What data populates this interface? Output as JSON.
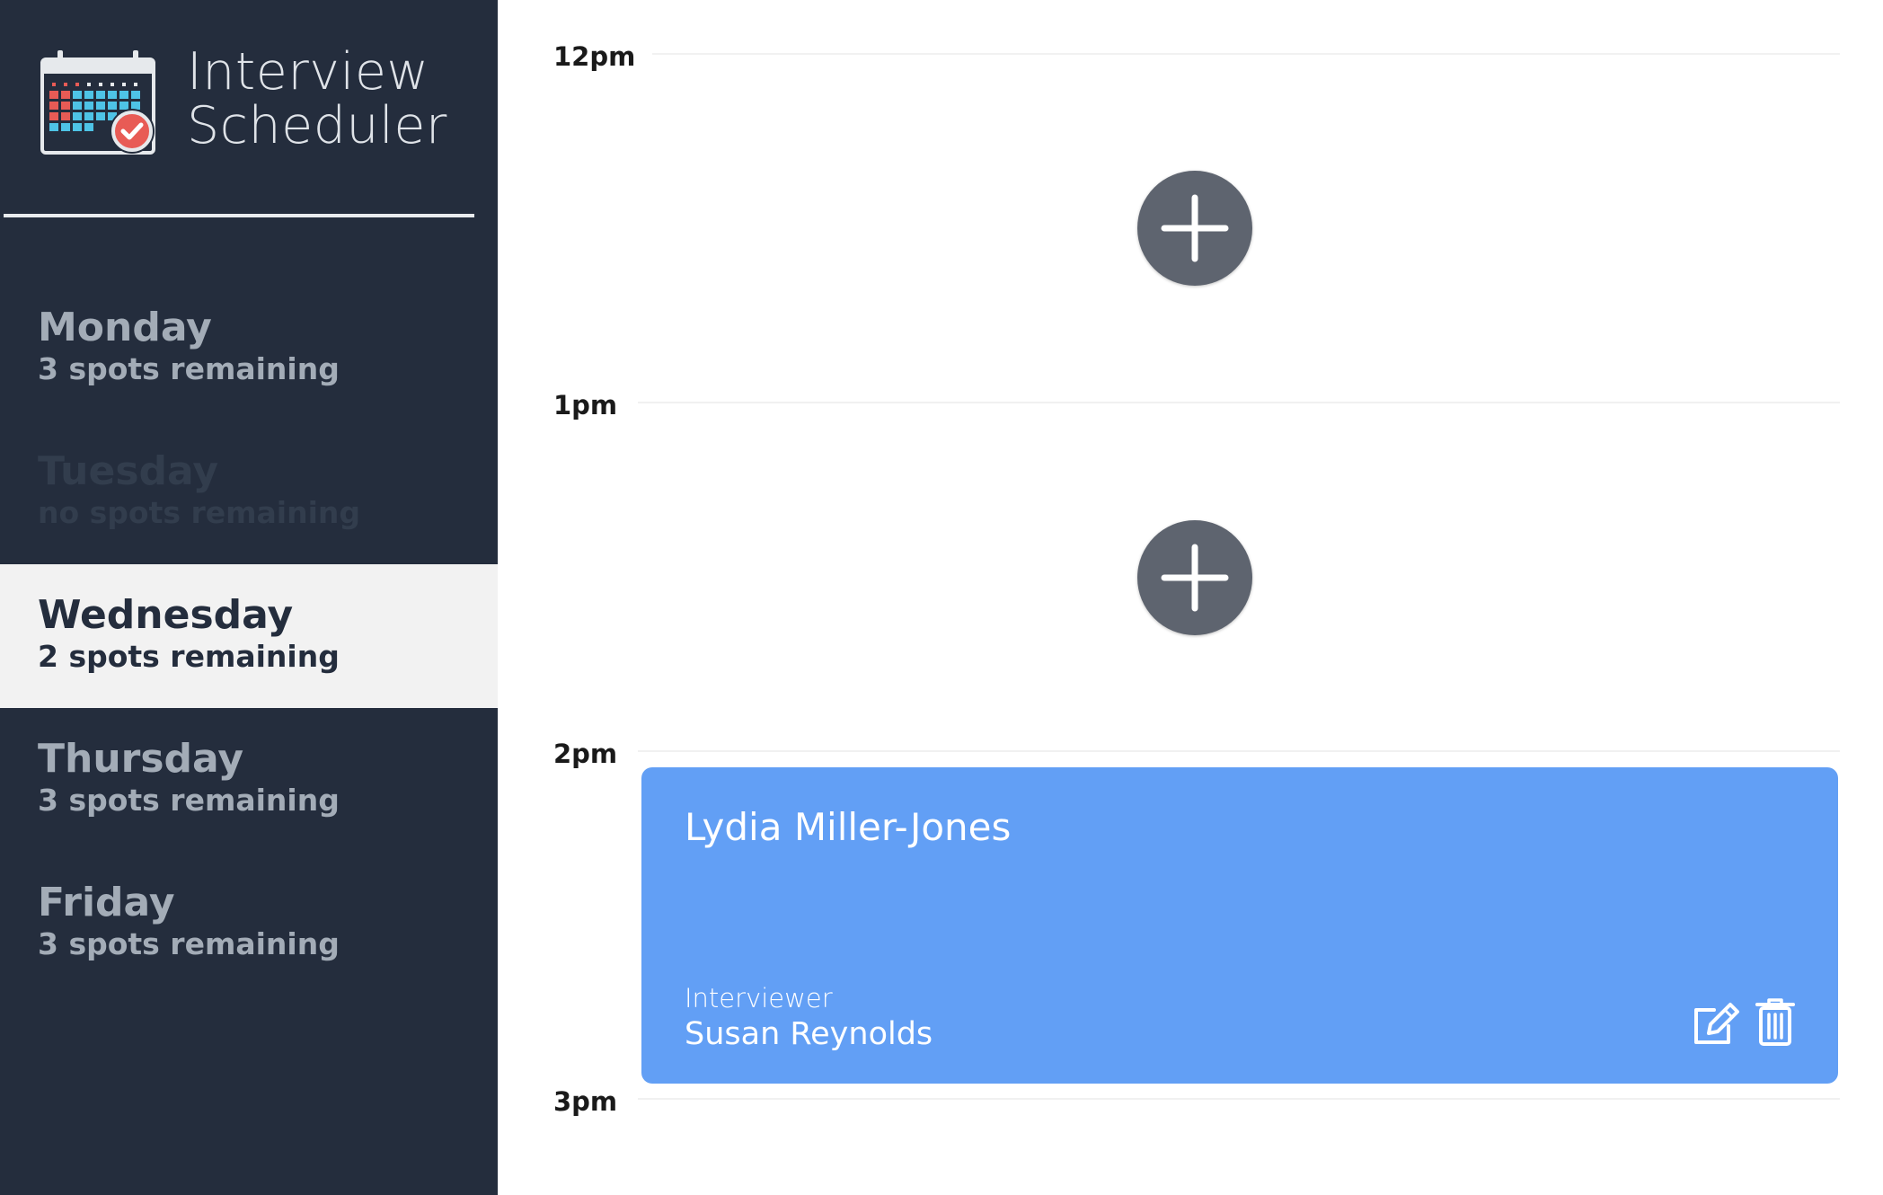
{
  "brand": {
    "title_line1": "Interview",
    "title_line2": "Scheduler",
    "logo_icon": "calendar-check-icon"
  },
  "days": [
    {
      "name": "Monday",
      "spots": "3 spots remaining",
      "state": "available"
    },
    {
      "name": "Tuesday",
      "spots": "no spots remaining",
      "state": "full"
    },
    {
      "name": "Wednesday",
      "spots": "2 spots remaining",
      "state": "selected"
    },
    {
      "name": "Thursday",
      "spots": "3 spots remaining",
      "state": "available"
    },
    {
      "name": "Friday",
      "spots": "3 spots remaining",
      "state": "available"
    }
  ],
  "schedule": {
    "hours": [
      "12pm",
      "1pm",
      "2pm",
      "3pm"
    ],
    "slots": [
      {
        "time": "12pm",
        "type": "empty",
        "icon": "add-icon"
      },
      {
        "time": "1pm",
        "type": "empty",
        "icon": "add-icon"
      },
      {
        "time": "2pm",
        "type": "booked"
      }
    ],
    "appointment": {
      "student": "Lydia Miller-Jones",
      "interviewer_label": "Interviewer",
      "interviewer_name": "Susan Reynolds",
      "edit_icon": "edit-icon",
      "delete_icon": "trash-icon"
    }
  },
  "colors": {
    "sidebar_bg": "#242d3d",
    "selected_bg": "#f2f2f2",
    "appointment_bg": "#629ff5",
    "add_button_bg": "#5e646f",
    "muted_text": "#a3acb7",
    "full_text": "#323d4d"
  }
}
